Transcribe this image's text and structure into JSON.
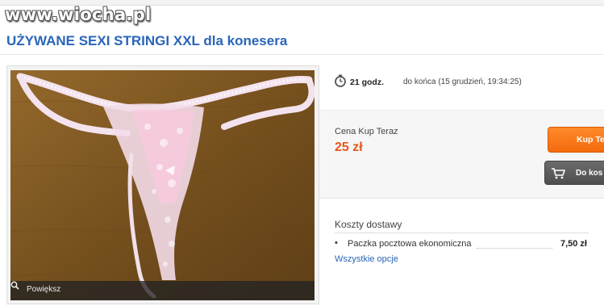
{
  "watermark": "www.wiocha.pl",
  "listing": {
    "title": "UŻYWANE SEXI STRINGI XXL dla konesera"
  },
  "gallery": {
    "zoom_label": "Powiększ",
    "zoom_icon": "magnifier-icon"
  },
  "timer": {
    "icon": "clock-icon",
    "time_left": "21 godz.",
    "until_text": "do końca (15 grudzień, 19:34:25)"
  },
  "buy": {
    "price_label": "Cena Kup Teraz",
    "price": "25 zł",
    "buy_now_label": "Kup Te",
    "add_to_cart_label": "Do kos",
    "cart_icon": "cart-icon"
  },
  "shipping": {
    "heading": "Koszty dostawy",
    "options": [
      {
        "name": "Paczka pocztowa ekonomiczna",
        "price": "7,50 zł"
      }
    ],
    "all_options_link": "Wszystkie opcje"
  },
  "colors": {
    "title_blue": "#2a65b8",
    "price_orange": "#e5571b",
    "buy_button": "#f36a0d",
    "cart_button": "#555555"
  }
}
